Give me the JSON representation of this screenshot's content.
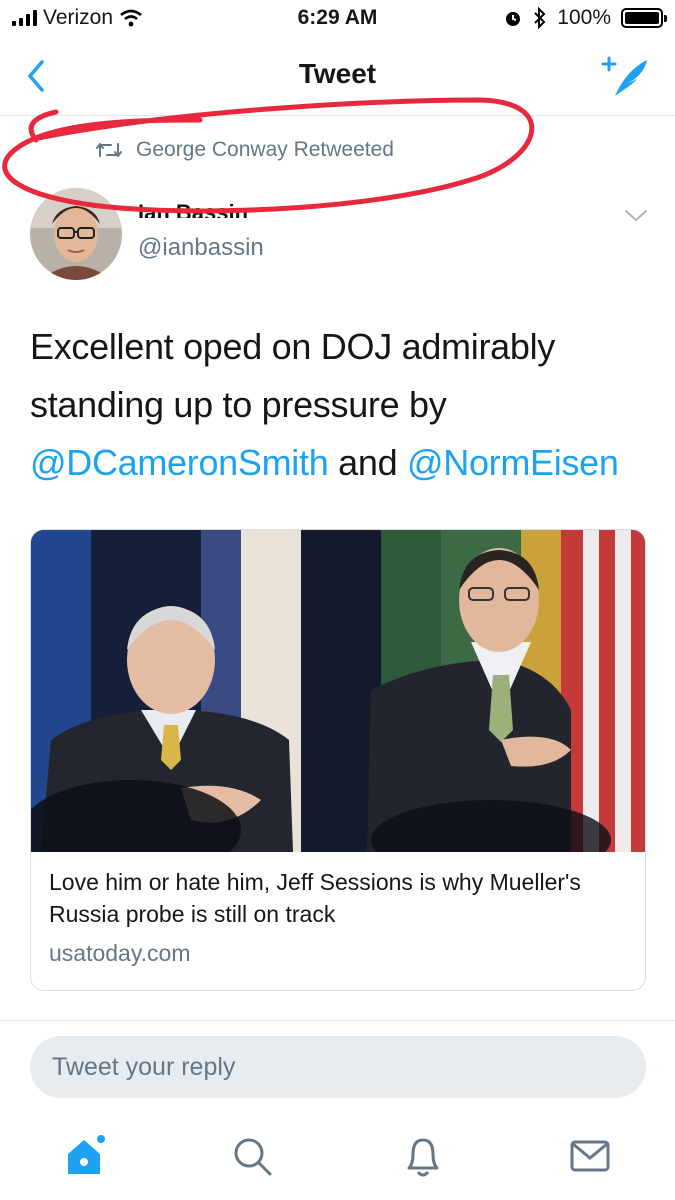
{
  "status_bar": {
    "carrier": "Verizon",
    "time": "6:29 AM",
    "battery": "100%"
  },
  "nav": {
    "title": "Tweet"
  },
  "retweet_context": "George Conway Retweeted",
  "author": {
    "name": "Ian Bassin",
    "handle": "@ianbassin"
  },
  "tweet": {
    "text_1": "Excellent oped on DOJ admirably standing up to pressure by ",
    "mention_1": "@DCameronSmith",
    "text_2": " and ",
    "mention_2": "@NormEisen"
  },
  "card": {
    "title": "Love him or hate him, Jeff Sessions is why Mueller's Russia probe is still on track",
    "domain": "usatoday.com"
  },
  "reply": {
    "placeholder": "Tweet your reply"
  },
  "colors": {
    "accent": "#1da1f2",
    "annotation": "#e8283c",
    "secondary_text": "#657786"
  },
  "icons": {
    "back": "chevron-left-icon",
    "compose": "compose-tweet-icon",
    "retweet": "retweet-icon",
    "menu": "chevron-down-icon",
    "tabs": [
      "home-icon",
      "search-icon",
      "notifications-icon",
      "messages-icon"
    ]
  }
}
